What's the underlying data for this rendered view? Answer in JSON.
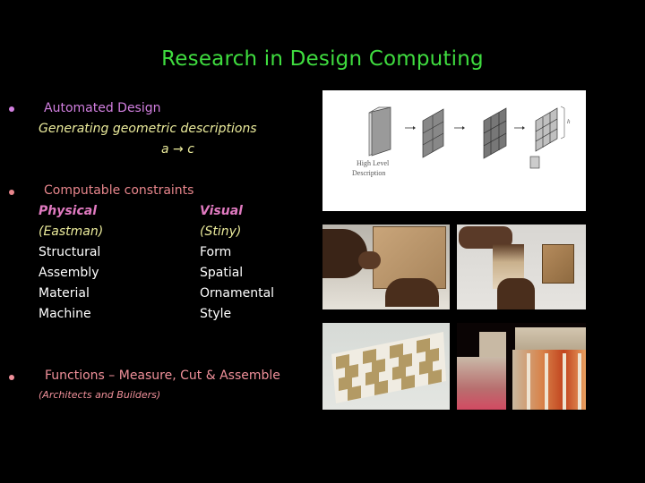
{
  "slide": {
    "title": "Research in Design Computing",
    "sections": [
      {
        "heading": "Automated Design",
        "sub": "Generating geometric descriptions",
        "formula": "a → c"
      },
      {
        "heading": "Computable constraints",
        "columns": [
          {
            "header": "Physical",
            "author": "(Eastman)",
            "items": [
              "Structural",
              "Assembly",
              "Material",
              "Machine"
            ]
          },
          {
            "header": "Visual",
            "author": "(Stiny)",
            "items": [
              "Form",
              "Spatial",
              "Ornamental",
              "Style"
            ]
          }
        ]
      },
      {
        "heading": "Functions – Measure, Cut & Assemble",
        "sub": "(Architects and Builders)"
      }
    ],
    "diagram": {
      "label_line1": "High Level",
      "label_line2": "Description",
      "dimension_label": "h"
    },
    "images": [
      {
        "name": "hands-assembling-wooden-cube"
      },
      {
        "name": "hands-folding-wooden-box"
      },
      {
        "name": "interlocking-block-wall"
      },
      {
        "name": "architectural-model-building"
      }
    ]
  },
  "colors": {
    "title": "#3fdc3f",
    "section1": "#d27fe0",
    "section2": "#e8868c",
    "section3": "#f0909a",
    "subtext_yellow": "#ecec9c",
    "column_header": "#e07ac0",
    "item": "#ffffff"
  }
}
